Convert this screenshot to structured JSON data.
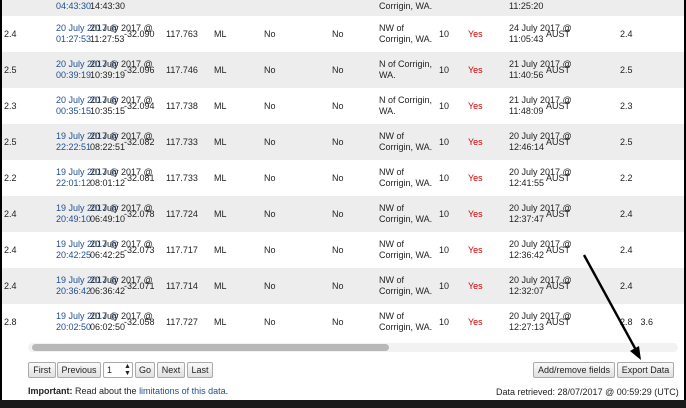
{
  "rows": [
    {
      "mag": "",
      "origin_date": "",
      "origin_time": "04:43:30",
      "local_date": "",
      "local_time": "14:43:30",
      "lat": "",
      "lon": "",
      "type": "",
      "felt": "",
      "tsunami": "",
      "place": "Corrigin, WA.",
      "depth": "",
      "yes": "",
      "upd_date": "",
      "upd_time": "11:25:20",
      "agency": "",
      "mag2": "",
      "extra": ""
    },
    {
      "mag": "2.4",
      "origin_date": "20 July 2017 @",
      "origin_time": "01:27:53",
      "local_date": "20 July 2017 @",
      "local_time": "11:27:53",
      "lat": "-32.090",
      "lon": "117.763",
      "type": "ML",
      "felt": "No",
      "tsunami": "No",
      "place": "NW of Corrigin, WA.",
      "depth": "10",
      "yes": "Yes",
      "upd_date": "24 July 2017 @",
      "upd_time": "11:05:43",
      "agency": "AUST",
      "mag2": "2.4",
      "extra": ""
    },
    {
      "mag": "2.5",
      "origin_date": "20 July 2017 @",
      "origin_time": "00:39:19",
      "local_date": "20 July 2017 @",
      "local_time": "10:39:19",
      "lat": "-32.096",
      "lon": "117.746",
      "type": "ML",
      "felt": "No",
      "tsunami": "No",
      "place": "N of Corrigin, WA.",
      "depth": "10",
      "yes": "Yes",
      "upd_date": "21 July 2017 @",
      "upd_time": "11:40:56",
      "agency": "AUST",
      "mag2": "2.5",
      "extra": ""
    },
    {
      "mag": "2.3",
      "origin_date": "20 July 2017 @",
      "origin_time": "00:35:15",
      "local_date": "20 July 2017 @",
      "local_time": "10:35:15",
      "lat": "-32.094",
      "lon": "117.738",
      "type": "ML",
      "felt": "No",
      "tsunami": "No",
      "place": "N of Corrigin, WA.",
      "depth": "10",
      "yes": "Yes",
      "upd_date": "21 July 2017 @",
      "upd_time": "11:48:09",
      "agency": "AUST",
      "mag2": "2.3",
      "extra": ""
    },
    {
      "mag": "2.5",
      "origin_date": "19 July 2017 @",
      "origin_time": "22:22:51",
      "local_date": "20 July 2017 @",
      "local_time": "08:22:51",
      "lat": "-32.082",
      "lon": "117.733",
      "type": "ML",
      "felt": "No",
      "tsunami": "No",
      "place": "NW of Corrigin, WA.",
      "depth": "10",
      "yes": "Yes",
      "upd_date": "20 July 2017 @",
      "upd_time": "12:46:14",
      "agency": "AUST",
      "mag2": "2.5",
      "extra": ""
    },
    {
      "mag": "2.2",
      "origin_date": "19 July 2017 @",
      "origin_time": "22:01:12",
      "local_date": "20 July 2017 @",
      "local_time": "08:01:12",
      "lat": "-32.081",
      "lon": "117.733",
      "type": "ML",
      "felt": "No",
      "tsunami": "No",
      "place": "NW of Corrigin, WA.",
      "depth": "10",
      "yes": "Yes",
      "upd_date": "20 July 2017 @",
      "upd_time": "12:41:55",
      "agency": "AUST",
      "mag2": "2.2",
      "extra": ""
    },
    {
      "mag": "2.4",
      "origin_date": "19 July 2017 @",
      "origin_time": "20:49:10",
      "local_date": "20 July 2017 @",
      "local_time": "06:49:10",
      "lat": "-32.078",
      "lon": "117.724",
      "type": "ML",
      "felt": "No",
      "tsunami": "No",
      "place": "NW of Corrigin, WA.",
      "depth": "10",
      "yes": "Yes",
      "upd_date": "20 July 2017 @",
      "upd_time": "12:37:47",
      "agency": "AUST",
      "mag2": "2.4",
      "extra": ""
    },
    {
      "mag": "2.4",
      "origin_date": "19 July 2017 @",
      "origin_time": "20:42:25",
      "local_date": "20 July 2017 @",
      "local_time": "06:42:25",
      "lat": "-32.073",
      "lon": "117.717",
      "type": "ML",
      "felt": "No",
      "tsunami": "No",
      "place": "NW of Corrigin, WA.",
      "depth": "10",
      "yes": "Yes",
      "upd_date": "20 July 2017 @",
      "upd_time": "12:36:42",
      "agency": "AUST",
      "mag2": "2.4",
      "extra": ""
    },
    {
      "mag": "2.4",
      "origin_date": "19 July 2017 @",
      "origin_time": "20:36:42",
      "local_date": "20 July 2017 @",
      "local_time": "06:36:42",
      "lat": "-32.071",
      "lon": "117.714",
      "type": "ML",
      "felt": "No",
      "tsunami": "No",
      "place": "NW of Corrigin, WA.",
      "depth": "10",
      "yes": "Yes",
      "upd_date": "20 July 2017 @",
      "upd_time": "12:32:07",
      "agency": "AUST",
      "mag2": "2.4",
      "extra": ""
    },
    {
      "mag": "2.8",
      "origin_date": "19 July 2017 @",
      "origin_time": "20:02:50",
      "local_date": "20 July 2017 @",
      "local_time": "06:02:50",
      "lat": "-32.058",
      "lon": "117.727",
      "type": "ML",
      "felt": "No",
      "tsunami": "No",
      "place": "NW of Corrigin, WA.",
      "depth": "10",
      "yes": "Yes",
      "upd_date": "20 July 2017 @",
      "upd_time": "12:27:13",
      "agency": "AUST",
      "mag2": "2.8",
      "extra": "3.6"
    }
  ],
  "pagination": {
    "first_label": "First",
    "previous_label": "Previous",
    "page_value": "1",
    "go_label": "Go",
    "next_label": "Next",
    "last_label": "Last"
  },
  "actions": {
    "add_remove_label": "Add/remove fields",
    "export_label": "Export Data"
  },
  "footer": {
    "important_label": "Important:",
    "important_pre": " Read about the ",
    "limitations_link": "limitations of this data",
    "important_post": ".",
    "retrieved": "Data retrieved: 28/07/2017 @ 00:59:29 (UTC)"
  },
  "colors": {
    "link": "#1f4e8f",
    "yes": "#cc0000",
    "row_alt": "#ededed"
  }
}
